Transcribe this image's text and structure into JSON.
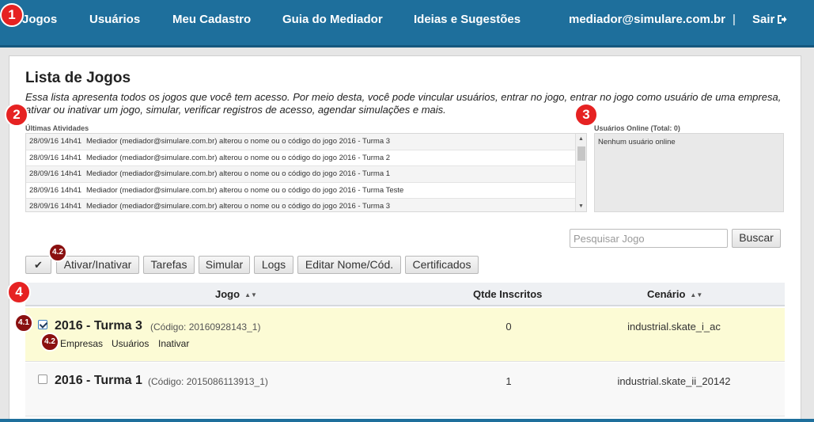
{
  "nav": {
    "items": [
      "Jogos",
      "Usuários",
      "Meu Cadastro",
      "Guia do Mediador",
      "Ideias e Sugestões"
    ],
    "user_email": "mediador@simulare.com.br",
    "separator": "|",
    "logout_label": "Sair"
  },
  "page": {
    "title": "Lista de Jogos",
    "description": "Essa lista apresenta todos os jogos que você tem acesso. Por meio desta, você pode vincular usuários, entrar no jogo, entrar no jogo como usuário de uma empresa, ativar ou inativar um jogo, simular, verificar registros de acesso, agendar simulações e mais."
  },
  "activities": {
    "label": "Últimas Atividades",
    "rows": [
      {
        "time": "28/09/16 14h41",
        "text": "Mediador (mediador@simulare.com.br) alterou o nome ou o código do jogo 2016 - Turma 3"
      },
      {
        "time": "28/09/16 14h41",
        "text": "Mediador (mediador@simulare.com.br) alterou o nome ou o código do jogo 2016 - Turma 2"
      },
      {
        "time": "28/09/16 14h41",
        "text": "Mediador (mediador@simulare.com.br) alterou o nome ou o código do jogo 2016 - Turma 1"
      },
      {
        "time": "28/09/16 14h41",
        "text": "Mediador (mediador@simulare.com.br) alterou o nome ou o código do jogo 2016 - Turma Teste"
      },
      {
        "time": "28/09/16 14h41",
        "text": "Mediador (mediador@simulare.com.br) alterou o nome ou o código do jogo 2016 - Turma 3"
      }
    ]
  },
  "online": {
    "label": "Usuários Online (Total: 0)",
    "empty_text": "Nenhum usuário online"
  },
  "search": {
    "placeholder": "Pesquisar Jogo",
    "button_label": "Buscar"
  },
  "toolbar": {
    "check_all": "✔",
    "buttons": [
      "Ativar/Inativar",
      "Tarefas",
      "Simular",
      "Logs",
      "Editar Nome/Cód.",
      "Certificados"
    ]
  },
  "table": {
    "headers": {
      "game": "Jogo",
      "enrolled": "Qtde Inscritos",
      "scenario": "Cenário"
    },
    "rows": [
      {
        "name": "2016 - Turma 3",
        "code": "(Código: 20160928143_1)",
        "enrolled": "0",
        "scenario": "industrial.skate_i_ac",
        "checked": true,
        "links": [
          "Empresas",
          "Usuários",
          "Inativar"
        ]
      },
      {
        "name": "2016 - Turma 1",
        "code": "(Código: 2015086113913_1)",
        "enrolled": "1",
        "scenario": "industrial.skate_ii_20142",
        "checked": false,
        "links": []
      }
    ]
  },
  "markers": [
    "1",
    "2",
    "3",
    "4",
    "4.1",
    "4.2",
    "4.2"
  ],
  "colors": {
    "nav_bg": "#1e6f9c",
    "selected_row": "#fcfbd5",
    "marker_big": "#e62222",
    "marker_small": "#8a1010"
  }
}
